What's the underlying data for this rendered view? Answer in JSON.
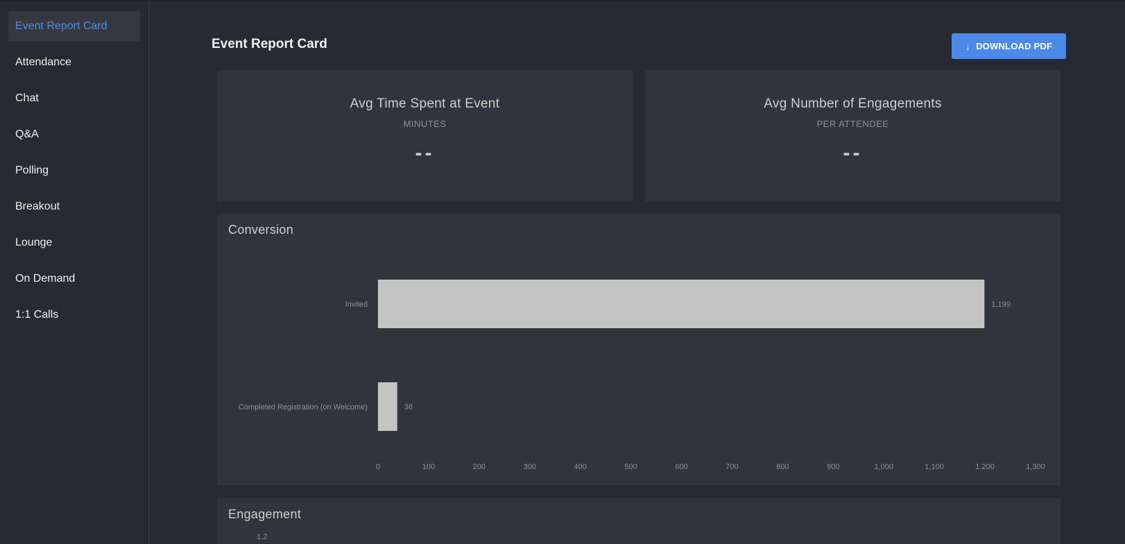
{
  "sidebar": {
    "items": [
      {
        "label": "Event Report Card",
        "active": true
      },
      {
        "label": "Attendance",
        "active": false
      },
      {
        "label": "Chat",
        "active": false
      },
      {
        "label": "Q&A",
        "active": false
      },
      {
        "label": "Polling",
        "active": false
      },
      {
        "label": "Breakout",
        "active": false
      },
      {
        "label": "Lounge",
        "active": false
      },
      {
        "label": "On Demand",
        "active": false
      },
      {
        "label": "1:1 Calls",
        "active": false
      }
    ]
  },
  "header": {
    "title": "Event Report Card",
    "download_label": "DOWNLOAD PDF",
    "download_icon": "arrow-down-icon"
  },
  "stats": [
    {
      "title": "Avg Time Spent at Event",
      "subtitle": "MINUTES",
      "value": "--"
    },
    {
      "title": "Avg Number of Engagements",
      "subtitle": "PER ATTENDEE",
      "value": "--"
    }
  ],
  "conversion": {
    "title": "Conversion"
  },
  "engagement": {
    "title": "Engagement",
    "first_tick": "1.2"
  },
  "colors": {
    "accent": "#4d8ae8",
    "bar": "#c4c4c4",
    "background": "#272a31",
    "card": "#31343b"
  },
  "chart_data": [
    {
      "type": "bar",
      "orientation": "horizontal",
      "title": "Conversion",
      "categories": [
        "Invited",
        "Completed Registration (on Welcome)"
      ],
      "values": [
        1199,
        38
      ],
      "value_labels": [
        "1,199",
        "38"
      ],
      "xlim": [
        0,
        1300
      ],
      "xticks": [
        0,
        100,
        200,
        300,
        400,
        500,
        600,
        700,
        800,
        900,
        1000,
        1100,
        1200,
        1300
      ],
      "xtick_labels": [
        "0",
        "100",
        "200",
        "300",
        "400",
        "500",
        "600",
        "700",
        "800",
        "900",
        "1,000",
        "1,100",
        "1,200",
        "1,300"
      ],
      "grid": false,
      "legend": "none"
    }
  ]
}
